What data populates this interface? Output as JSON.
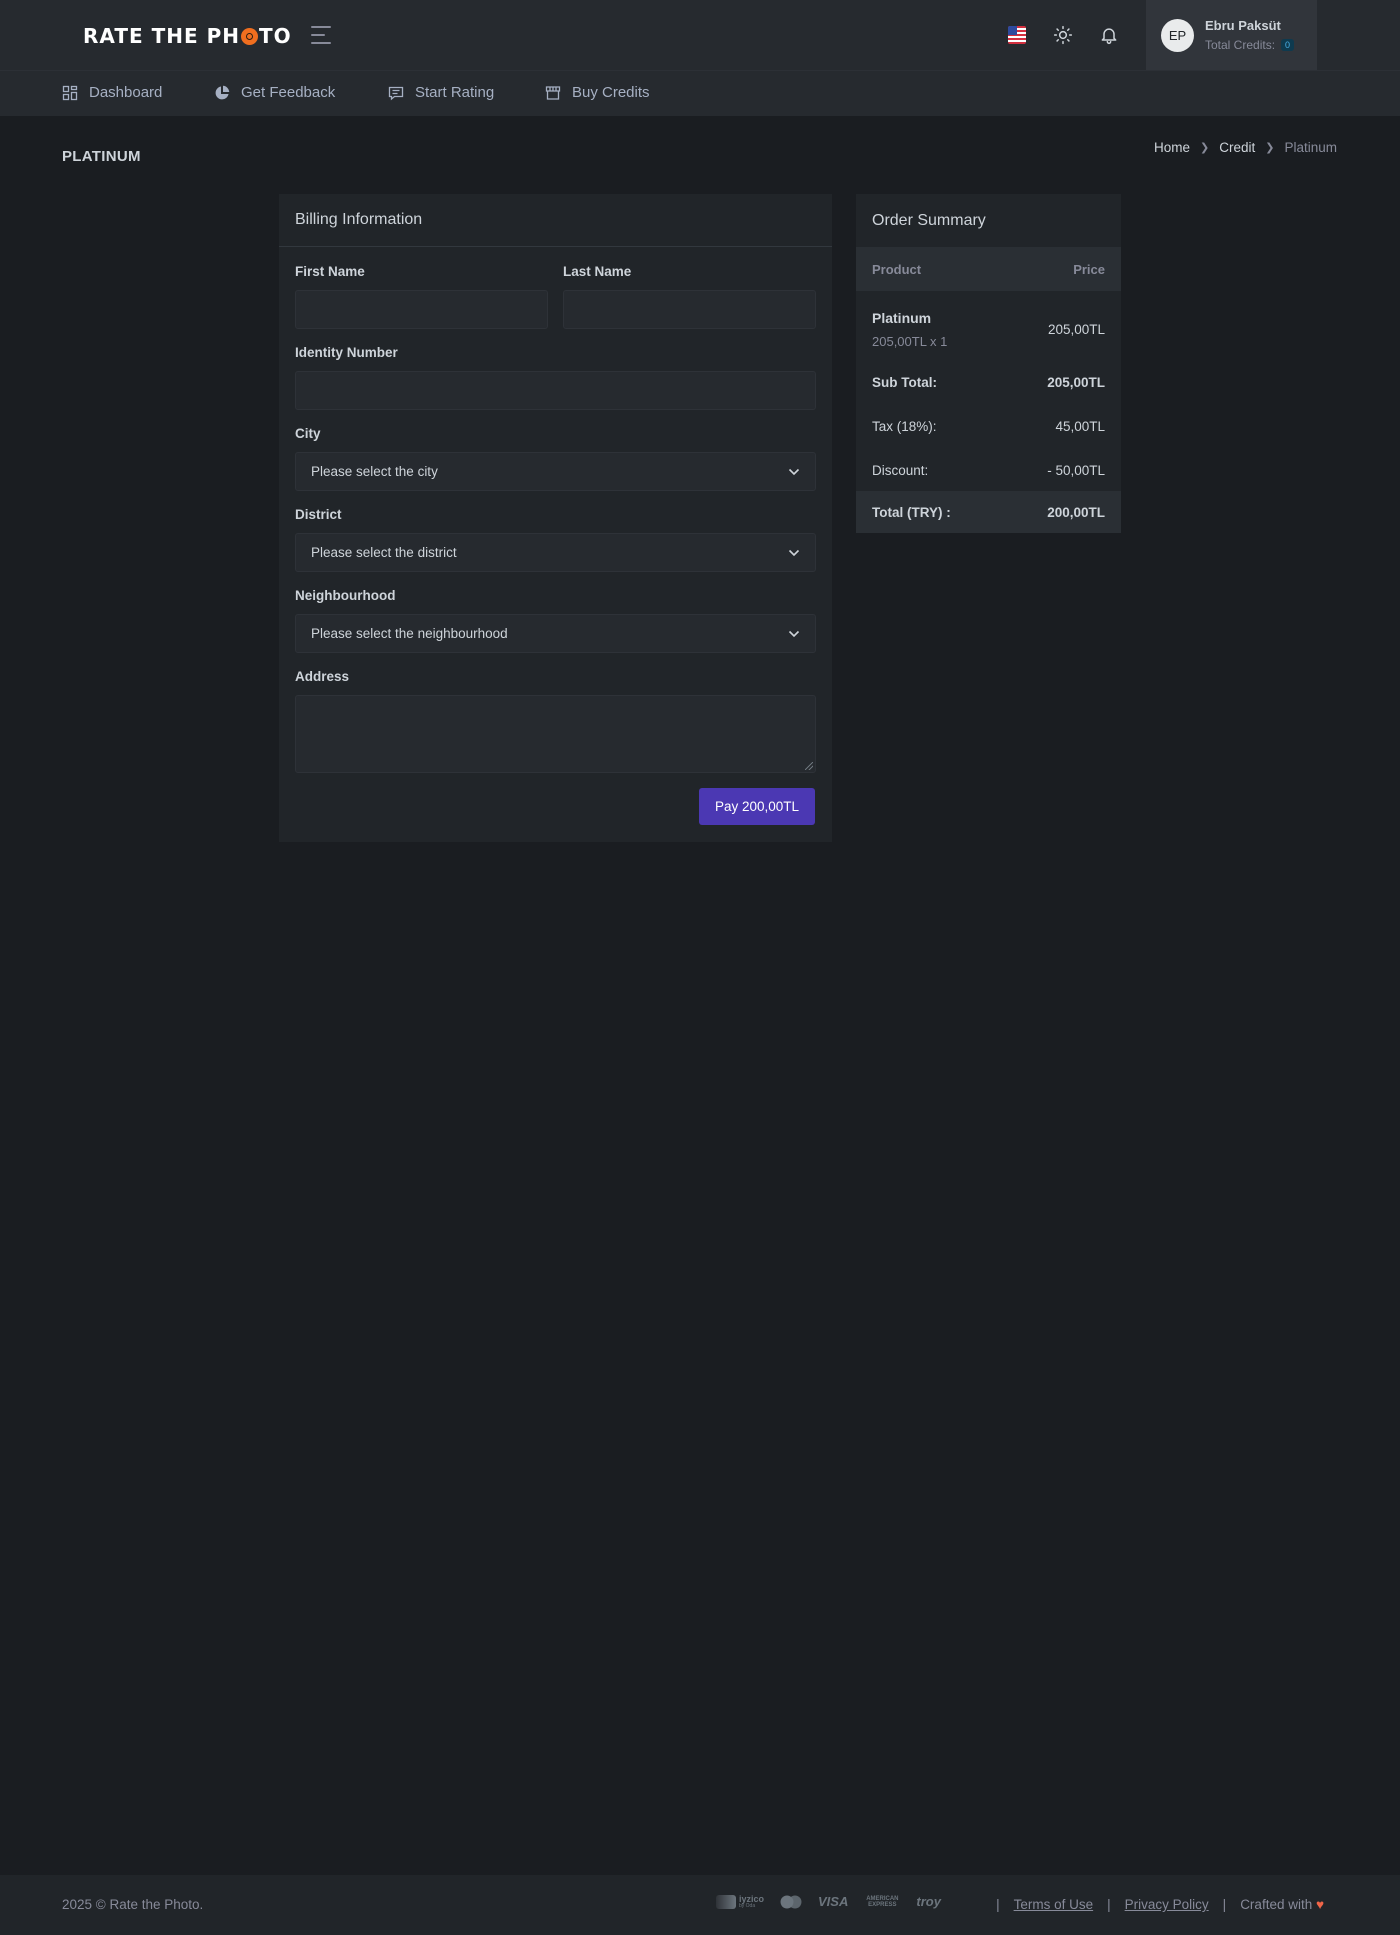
{
  "brand": {
    "logo_part1": "RATE THE PH",
    "logo_part2": "TO"
  },
  "header": {
    "user_initials": "EP",
    "user_name": "Ebru Paksüt",
    "credits_label": "Total Credits:",
    "credits_value": "0"
  },
  "nav": {
    "items": [
      {
        "label": "Dashboard",
        "icon": "dashboard-icon"
      },
      {
        "label": "Get Feedback",
        "icon": "pie-chart-icon"
      },
      {
        "label": "Start Rating",
        "icon": "chat-icon"
      },
      {
        "label": "Buy Credits",
        "icon": "store-icon"
      }
    ]
  },
  "page": {
    "title": "PLATINUM",
    "breadcrumb": [
      "Home",
      "Credit",
      "Platinum"
    ]
  },
  "billing": {
    "title": "Billing Information",
    "first_name_label": "First Name",
    "last_name_label": "Last Name",
    "identity_label": "Identity Number",
    "city_label": "City",
    "city_value": "Please select the city",
    "district_label": "District",
    "district_value": "Please select the district",
    "neighbourhood_label": "Neighbourhood",
    "neighbourhood_value": "Please select the neighbourhood",
    "address_label": "Address",
    "pay_button": "Pay 200,00TL"
  },
  "summary": {
    "title": "Order Summary",
    "col_product": "Product",
    "col_price": "Price",
    "product_name": "Platinum",
    "product_qty": "205,00TL x 1",
    "product_price": "205,00TL",
    "subtotal_label": "Sub Total:",
    "subtotal_value": "205,00TL",
    "tax_label": "Tax (18%):",
    "tax_value": "45,00TL",
    "discount_label": "Discount:",
    "discount_value": "- 50,00TL",
    "total_label": "Total (TRY) :",
    "total_value": "200,00TL"
  },
  "footer": {
    "copyright": "2025 © Rate the Photo.",
    "payment_logos": [
      "iyzico",
      "VISA",
      "AMERICAN EXPRESS",
      "troy"
    ],
    "iyzico_sub": "by Oda",
    "terms": "Terms of Use",
    "privacy": "Privacy Policy",
    "crafted": "Crafted with"
  },
  "colors": {
    "background": "#1a1d21",
    "topbar": "#262a2f",
    "card": "#212529",
    "primary_button": "#4b38b3",
    "accent_orange": "#f06e1f",
    "heart": "#f06548"
  }
}
